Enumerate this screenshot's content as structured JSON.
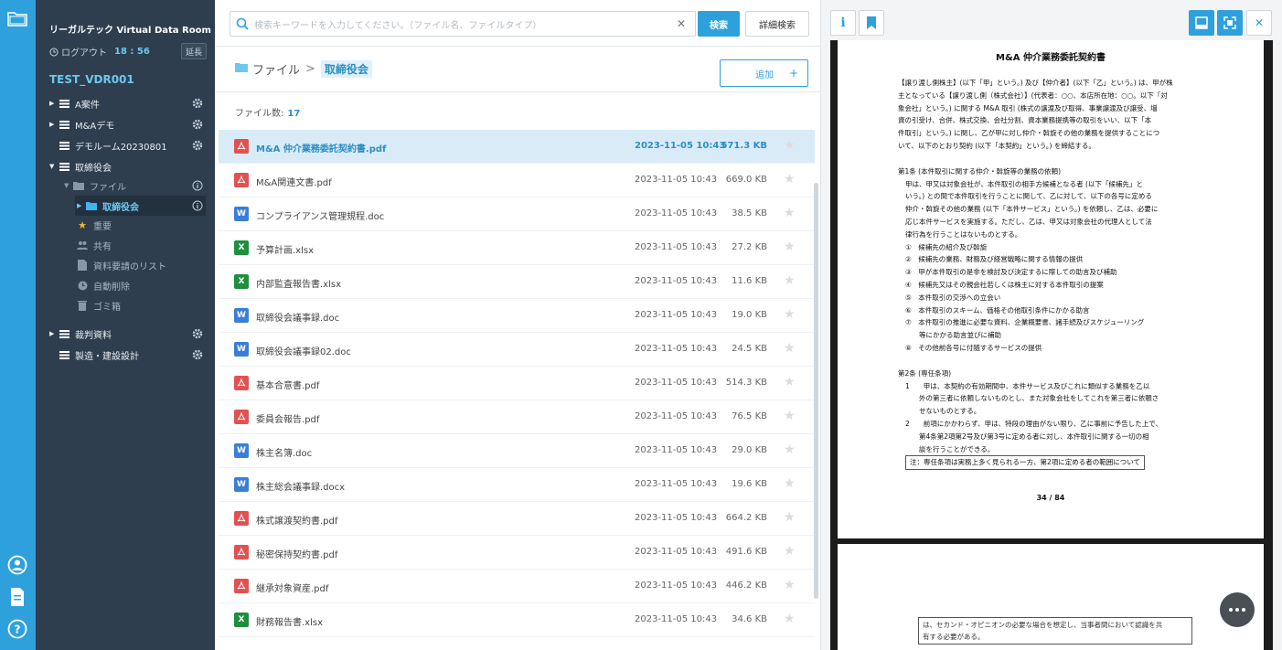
{
  "sidebar": {
    "title": "リーガルテック Virtual Data Room",
    "logout_label": "ログアウト",
    "logout_time": "18 : 56",
    "extend_label": "延長",
    "project": "TEST_VDR001",
    "tree": [
      {
        "label": "A案件"
      },
      {
        "label": "M&Aデモ"
      },
      {
        "label": "デモルーム20230801"
      },
      {
        "label": "取締役会"
      },
      {
        "label": "ファイル"
      },
      {
        "label": "取締役会"
      },
      {
        "label": "重要"
      },
      {
        "label": "共有"
      },
      {
        "label": "資料要請のリスト"
      },
      {
        "label": "自動削除"
      },
      {
        "label": "ゴミ箱"
      },
      {
        "label": "裁判資料"
      },
      {
        "label": "製造・建設設計"
      }
    ]
  },
  "search": {
    "placeholder": "検索キーワードを入力してください。（ファイル名、ファイルタイプ）",
    "search_button": "検索",
    "advanced_button": "詳細検索"
  },
  "breadcrumb": {
    "root": "ファイル",
    "sep": ">",
    "current": "取締役会"
  },
  "add_button": "追加",
  "file_count_label": "ファイル数:",
  "file_count": "17",
  "files": [
    {
      "name": "M&A 仲介業務委託契約書.pdf",
      "type": "pdf",
      "date": "2023-11-05 10:43",
      "size": "571.3 KB"
    },
    {
      "name": "M&A関連文書.pdf",
      "type": "pdf",
      "date": "2023-11-05 10:43",
      "size": "669.0 KB"
    },
    {
      "name": "コンプライアンス管理規程.doc",
      "type": "doc",
      "date": "2023-11-05 10:43",
      "size": "38.5 KB"
    },
    {
      "name": "予算計画.xlsx",
      "type": "xls",
      "date": "2023-11-05 10:43",
      "size": "27.2 KB"
    },
    {
      "name": "内部監査報告書.xlsx",
      "type": "xls",
      "date": "2023-11-05 10:43",
      "size": "11.6 KB"
    },
    {
      "name": "取締役会議事録.doc",
      "type": "doc",
      "date": "2023-11-05 10:43",
      "size": "19.0 KB"
    },
    {
      "name": "取締役会議事録02.doc",
      "type": "doc",
      "date": "2023-11-05 10:43",
      "size": "24.5 KB"
    },
    {
      "name": "基本合意書.pdf",
      "type": "pdf",
      "date": "2023-11-05 10:43",
      "size": "514.3 KB"
    },
    {
      "name": "委員会報告.pdf",
      "type": "pdf",
      "date": "2023-11-05 10:43",
      "size": "76.5 KB"
    },
    {
      "name": "株主名簿.doc",
      "type": "doc",
      "date": "2023-11-05 10:43",
      "size": "29.0 KB"
    },
    {
      "name": "株主総会議事録.docx",
      "type": "doc",
      "date": "2023-11-05 10:43",
      "size": "19.6 KB"
    },
    {
      "name": "株式譲渡契約書.pdf",
      "type": "pdf",
      "date": "2023-11-05 10:43",
      "size": "664.2 KB"
    },
    {
      "name": "秘密保持契約書.pdf",
      "type": "pdf",
      "date": "2023-11-05 10:43",
      "size": "491.6 KB"
    },
    {
      "name": "継承対象資産.pdf",
      "type": "pdf",
      "date": "2023-11-05 10:43",
      "size": "446.2 KB"
    },
    {
      "name": "財務報告書.xlsx",
      "type": "xls",
      "date": "2023-11-05 10:43",
      "size": "34.6 KB"
    }
  ],
  "preview": {
    "doc_title": "M&A 仲介業務委託契約書",
    "lines": [
      "【譲り渡し側株主】(以下「甲」という。) 及び【仲介者】(以下「乙」という。) は、甲が株",
      "主となっている【譲り渡し側（株式会社）】(代表者：○○、本店所在地：○○。以下「対",
      "象会社」という。) に関する M&A 取引 (株式の譲渡及び取得、事業譲渡及び譲受、増",
      "資の引受け、合併、株式交換、会社分割、資本業務提携等の取引をいい、以下「本",
      "件取引」という。) に関し、乙が甲に対し仲介・斡旋その他の業務を提供することにつ",
      "いて、以下のとおり契約 (以下「本契約」という。) を締結する。"
    ],
    "art1_heading": "第1条 (本件取引に関する仲介・斡旋等の業務の依頼)",
    "art1_lines": [
      "甲は、甲又は対象会社が、本件取引の相手方候補となる者 (以下「候補先」と",
      "いう。) との間で本件取引を行うことに関して、乙に対して、以下の各号に定める",
      "仲介・斡旋その他の業務 (以下「本件サービス」という。) を依頼し、乙は、必要に",
      "応じ本件サービスを実施する。ただし、乙は、甲又は対象会社の代理人として法",
      "律行為を行うことはないものとする。"
    ],
    "art1_items": [
      "①　候補先の紹介及び斡旋",
      "②　候補先の業務、財務及び経営戦略に関する情報の提供",
      "③　甲が本件取引の是非を検討及び決定するに際しての助言及び補助",
      "④　候補先又はその親会社若しくは株主に対する本件取引の提案",
      "⑤　本件取引の交渉への立会い",
      "⑥　本件取引のスキーム、価格その他取引条件にかかる助言",
      "⑦　本件取引の推進に必要な資料、企業概要書、諸手続及びスケジューリング",
      "　　等にかかる助言並びに補助",
      "⑧　その他前各号に付随するサービスの提供"
    ],
    "art2_heading": "第2条 (専任条項)",
    "art2_lines": [
      "1　　甲は、本契約の有効期間中、本件サービス及びこれに類似する業務を乙以",
      "　　外の第三者に依頼しないものとし、また対象会社をしてこれを第三者に依頼さ",
      "　　せないものとする。",
      "2　　前項にかかわらず、甲は、特段の理由がない限り、乙に事前に予告した上で、",
      "　　第4条第2項第2号及び第3号に定める者に対し、本件取引に関する一切の相",
      "　　談を行うことができる。"
    ],
    "note1": "注：専任条項は実務上多く見られる一方、第2項に定める者の範囲について",
    "page_num": "34 / 84",
    "note2_a": "は、セカンド・オピニオンの必要な場合を想定し、当事者間において認識を共",
    "note2_b": "有する必要がある。"
  },
  "colors": {
    "accent": "#2ea1dd",
    "sidebar": "#2f3e4e",
    "pdf": "#e05252",
    "doc": "#3a7fd5",
    "xls": "#1f8e3d"
  }
}
